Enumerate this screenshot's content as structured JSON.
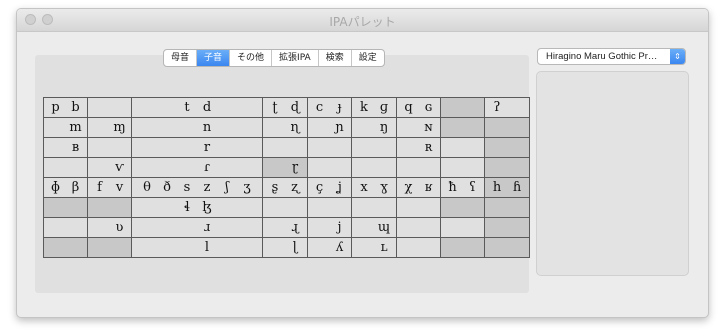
{
  "window": {
    "title": "IPAパレット"
  },
  "tabs": [
    {
      "label": "母音",
      "active": false
    },
    {
      "label": "子音",
      "active": true
    },
    {
      "label": "その他",
      "active": false
    },
    {
      "label": "拡張IPA",
      "active": false
    },
    {
      "label": "検索",
      "active": false
    },
    {
      "label": "設定",
      "active": false
    }
  ],
  "font_selector": {
    "value": "Hiragino Maru Gothic Pr…",
    "icon": "up-down-chevron-icon"
  },
  "consonant_rows": [
    [
      [
        "p",
        "b"
      ],
      [
        "",
        ""
      ],
      [
        "t",
        "d"
      ],
      [
        "ʈ",
        "ɖ"
      ],
      [
        "c",
        "ɟ"
      ],
      [
        "k",
        "ɡ"
      ],
      [
        "q",
        "ɢ"
      ],
      [
        "",
        ""
      ],
      [
        "ʔ",
        ""
      ]
    ],
    [
      [
        "",
        "m"
      ],
      [
        "",
        "ɱ"
      ],
      [
        "",
        "n"
      ],
      [
        "",
        "ɳ"
      ],
      [
        "",
        "ɲ"
      ],
      [
        "",
        "ŋ"
      ],
      [
        "",
        "ɴ"
      ],
      [
        "",
        ""
      ],
      [
        "",
        ""
      ]
    ],
    [
      [
        "",
        "ʙ"
      ],
      [
        "",
        ""
      ],
      [
        "",
        "r"
      ],
      [
        "",
        ""
      ],
      [
        "",
        ""
      ],
      [
        "",
        ""
      ],
      [
        "",
        "ʀ"
      ],
      [
        "",
        ""
      ],
      [
        "",
        ""
      ]
    ],
    [
      [
        "",
        ""
      ],
      [
        "",
        "ⱱ"
      ],
      [
        "",
        "ɾ"
      ],
      [
        "",
        "ɽ"
      ],
      [
        "",
        ""
      ],
      [
        "",
        ""
      ],
      [
        "",
        ""
      ],
      [
        "",
        ""
      ],
      [
        "",
        ""
      ]
    ],
    [
      [
        "ɸ",
        "β"
      ],
      [
        "f",
        "v"
      ],
      [
        "θ",
        "ð",
        "s",
        "z",
        "ʃ",
        "ʒ"
      ],
      [
        "ʂ",
        "ʐ"
      ],
      [
        "ç",
        "ʝ"
      ],
      [
        "x",
        "ɣ"
      ],
      [
        "χ",
        "ʁ"
      ],
      [
        "ħ",
        "ʕ"
      ],
      [
        "h",
        "ɦ"
      ]
    ],
    [
      [
        "",
        ""
      ],
      [
        "",
        ""
      ],
      [
        "ɬ",
        "ɮ"
      ],
      [
        "",
        ""
      ],
      [
        "",
        ""
      ],
      [
        "",
        ""
      ],
      [
        "",
        ""
      ],
      [
        "",
        ""
      ],
      [
        "",
        ""
      ]
    ],
    [
      [
        "",
        ""
      ],
      [
        "",
        "ʋ"
      ],
      [
        "",
        "ɹ"
      ],
      [
        "",
        "ɻ"
      ],
      [
        "",
        "j"
      ],
      [
        "",
        "ɰ"
      ],
      [
        "",
        ""
      ],
      [
        "",
        ""
      ],
      [
        "",
        ""
      ]
    ],
    [
      [
        "",
        ""
      ],
      [
        "",
        ""
      ],
      [
        "",
        "l"
      ],
      [
        "",
        "ɭ"
      ],
      [
        "",
        "ʎ"
      ],
      [
        "",
        "ʟ"
      ],
      [
        "",
        ""
      ],
      [
        "",
        ""
      ],
      [
        "",
        ""
      ]
    ]
  ]
}
